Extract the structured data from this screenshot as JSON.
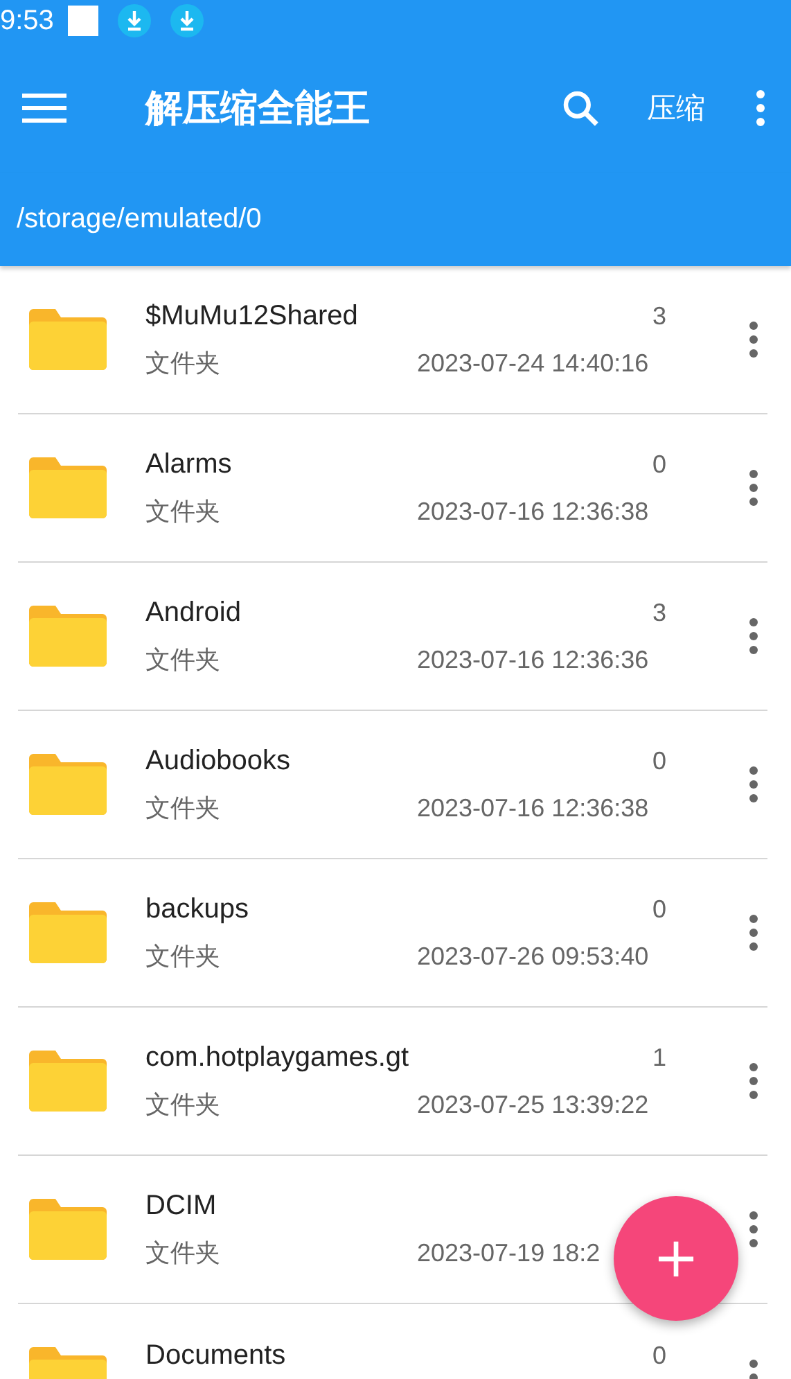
{
  "status_bar": {
    "time": "9:53"
  },
  "toolbar": {
    "title": "解压缩全能王",
    "action": "压缩"
  },
  "path": "/storage/emulated/0",
  "files": [
    {
      "name": "$MuMu12Shared",
      "type": "文件夹",
      "count": "3",
      "date": "2023-07-24 14:40:16"
    },
    {
      "name": "Alarms",
      "type": "文件夹",
      "count": "0",
      "date": "2023-07-16 12:36:38"
    },
    {
      "name": "Android",
      "type": "文件夹",
      "count": "3",
      "date": "2023-07-16 12:36:36"
    },
    {
      "name": "Audiobooks",
      "type": "文件夹",
      "count": "0",
      "date": "2023-07-16 12:36:38"
    },
    {
      "name": "backups",
      "type": "文件夹",
      "count": "0",
      "date": "2023-07-26 09:53:40"
    },
    {
      "name": "com.hotplaygames.gt",
      "type": "文件夹",
      "count": "1",
      "date": "2023-07-25 13:39:22"
    },
    {
      "name": "DCIM",
      "type": "文件夹",
      "date": "2023-07-19 18:2"
    },
    {
      "name": "Documents",
      "count": "0"
    }
  ],
  "fab": {
    "label": "+"
  }
}
